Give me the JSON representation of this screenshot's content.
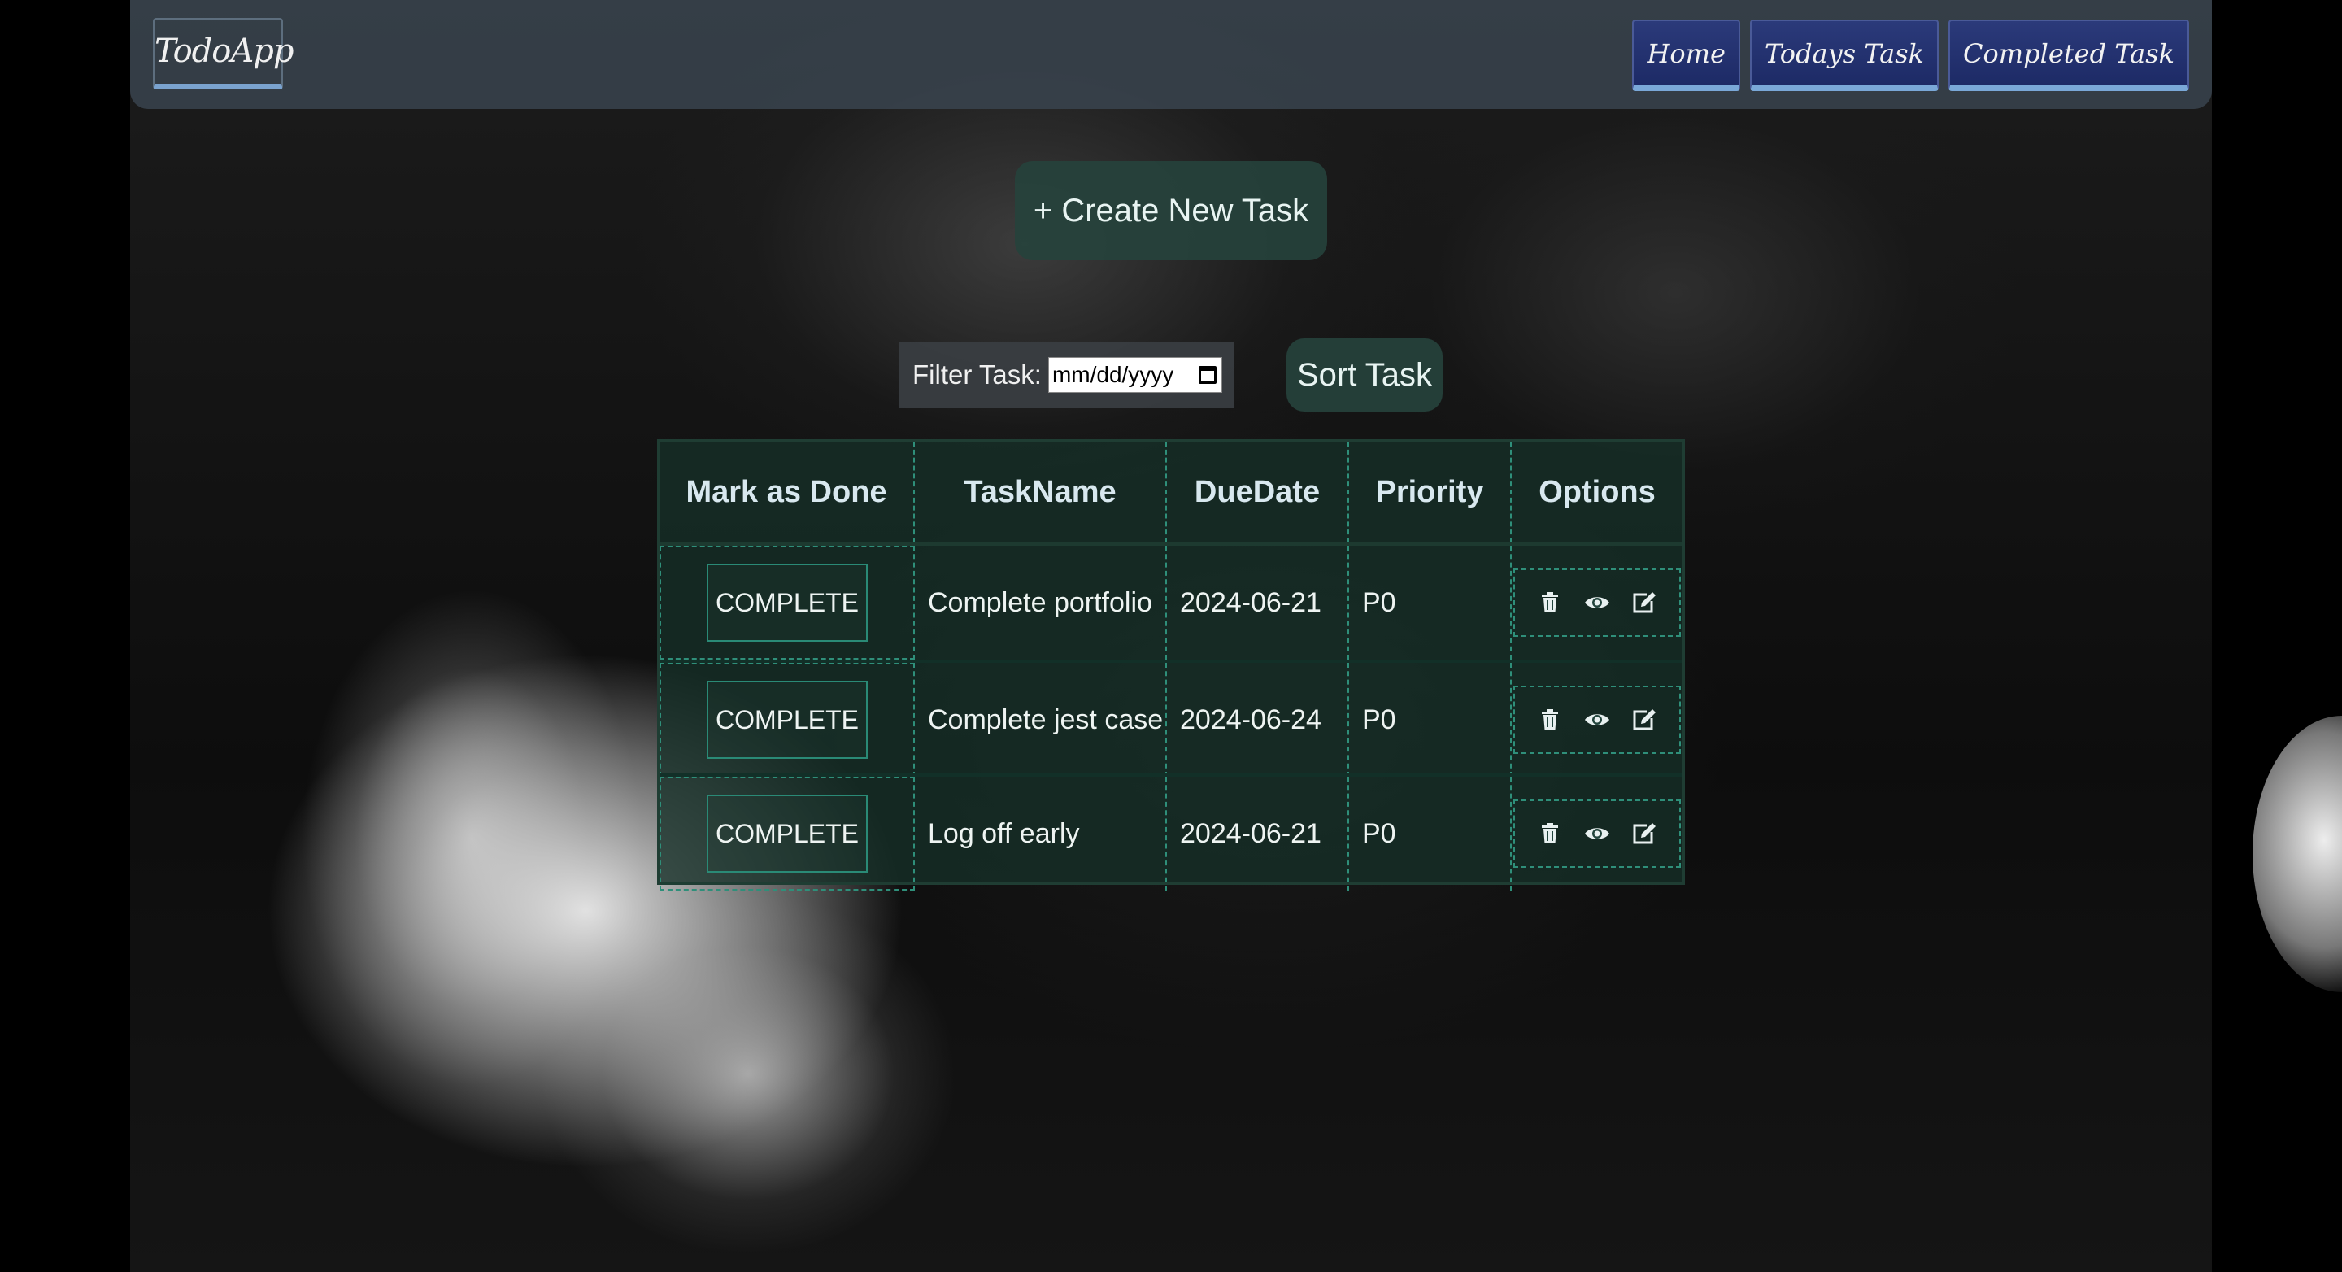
{
  "navbar": {
    "brand": "TodoApp",
    "links": [
      {
        "label": "Home"
      },
      {
        "label": "Todays Task"
      },
      {
        "label": "Completed Task"
      }
    ]
  },
  "actions": {
    "create_label": "+ Create New Task",
    "filter_label": "Filter Task:",
    "date_placeholder": "mm/dd/yyyy",
    "sort_label": "Sort Task"
  },
  "table": {
    "headers": [
      "Mark as Done",
      "TaskName",
      "DueDate",
      "Priority",
      "Options"
    ],
    "rows": [
      {
        "action_label": "COMPLETE",
        "task": "Complete portfolio",
        "due": "2024-06-21",
        "priority": "P0"
      },
      {
        "action_label": "COMPLETE",
        "task": "Complete jest case",
        "due": "2024-06-24",
        "priority": "P0"
      },
      {
        "action_label": "COMPLETE",
        "task": "Log off early",
        "due": "2024-06-21",
        "priority": "P0"
      }
    ],
    "option_icons": [
      "trash-icon",
      "eye-icon",
      "edit-icon"
    ]
  },
  "colors": {
    "navbar_bg": "#3a4650",
    "nav_button_bg": "#1d2a66",
    "nav_button_underline": "#7aa8d8",
    "accent_green": "#26423c",
    "dashed_border": "#2f8f7a",
    "text": "#eef4f2"
  }
}
